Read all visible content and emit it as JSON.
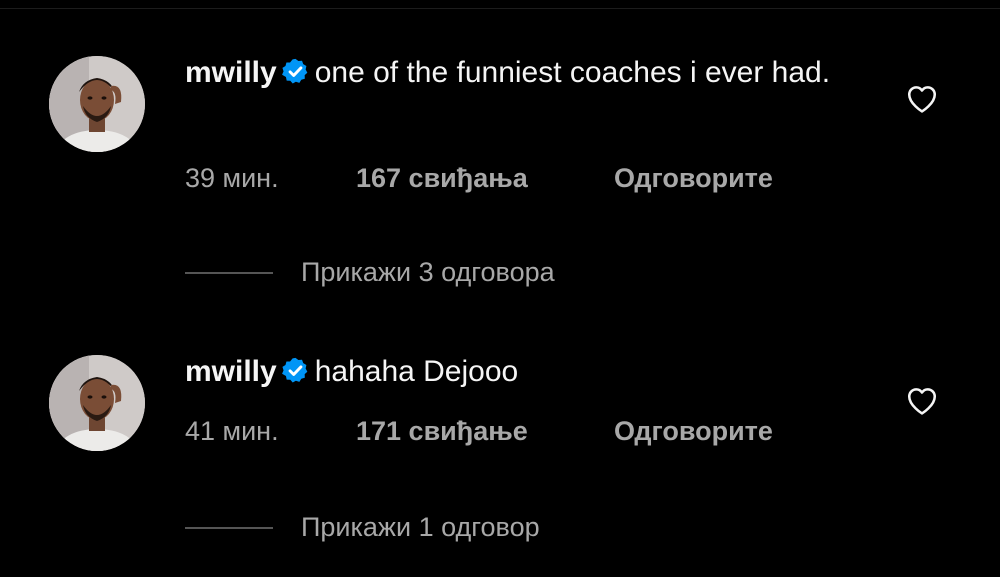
{
  "comments": [
    {
      "username": "mwilly",
      "text": "one of the funniest coaches i ever had.",
      "time": "39 мин.",
      "likes": "167 свиђања",
      "reply_label": "Одговорите",
      "view_replies": "Прикажи 3 одговора"
    },
    {
      "username": "mwilly",
      "text": "hahaha Dejooo",
      "time": "41 мин.",
      "likes": "171 свиђање",
      "reply_label": "Одговорите",
      "view_replies": "Прикажи 1 одговор"
    }
  ],
  "icons": {
    "verified": "verified-badge-icon",
    "like": "heart-outline-icon"
  },
  "colors": {
    "background": "#000000",
    "primary_text": "#f5f5f5",
    "secondary_text": "#a8a8a8",
    "verified_blue": "#0095f6"
  }
}
